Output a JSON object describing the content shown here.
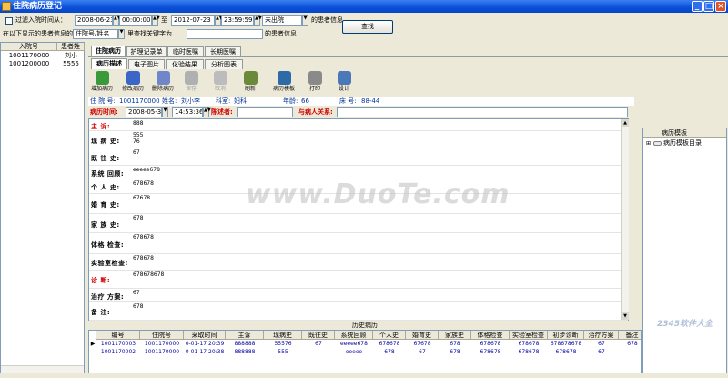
{
  "window": {
    "title": "住院病历登记",
    "icon": "hospital-app-icon"
  },
  "filter": {
    "checkbox_label": "过滤入院时间从：",
    "date_from": "2008-06-23",
    "time_from": "00:00:00",
    "to_label": "至",
    "date_to": "2012-07-23",
    "time_to": "23:59:59",
    "status_value": "未出院",
    "status_suffix": "的患者信息",
    "search_prefix": "在以下显示的患者信息的",
    "search_field": "住院号/姓名",
    "search_mid": "里查找关键字为",
    "search_value": "",
    "search_suffix": "的患者信息",
    "find_button": "查找"
  },
  "patients": {
    "columns": [
      "入院号",
      "患者姓"
    ],
    "rows": [
      [
        "1001170000",
        "刘小"
      ],
      [
        "1001200000",
        "5555"
      ]
    ]
  },
  "main_tabs": [
    "住院病历",
    "护理记录单",
    "临时医嘱",
    "长期医嘱"
  ],
  "sub_tabs": [
    "病历描述",
    "电子图片",
    "化验结果",
    "分析图表"
  ],
  "toolbar": [
    {
      "label": "增加病历",
      "icon": "add-record-icon",
      "color": "#3a9a3a",
      "enabled": true
    },
    {
      "label": "修改病历",
      "icon": "edit-record-icon",
      "color": "#3a66c8",
      "enabled": true
    },
    {
      "label": "删除病历",
      "icon": "delete-record-icon",
      "color": "#6f86c8",
      "enabled": true
    },
    {
      "label": "保存",
      "icon": "save-icon",
      "color": "#9a9a9a",
      "enabled": false
    },
    {
      "label": "取消",
      "icon": "cancel-icon",
      "color": "#a8a8a8",
      "enabled": false
    },
    {
      "label": "刷新",
      "icon": "refresh-icon",
      "color": "#6a8a3a",
      "enabled": true
    },
    {
      "label": "病历模板",
      "icon": "template-icon",
      "color": "#2f6aa8",
      "enabled": true
    },
    {
      "label": "打印",
      "icon": "printer-icon",
      "color": "#8a8a8a",
      "enabled": true
    },
    {
      "label": "设计",
      "icon": "design-icon",
      "color": "#4a78b8",
      "enabled": true
    }
  ],
  "info": {
    "id_label": "住 院 号:",
    "id_value": "1001170000",
    "name_label": "姓名:",
    "name_value": "刘小李",
    "dept_label": "科室:",
    "dept_value": "妇科",
    "age_label": "年龄:",
    "age_value": "66",
    "bed_label": "床 号:",
    "bed_value": "88-44"
  },
  "record_header": {
    "time_label": "病历时间:",
    "date": "2008-05-30",
    "time": "14:53:36",
    "writer_label": "陈述者:",
    "writer_value": "",
    "relation_label": "与病人关系:",
    "relation_value": ""
  },
  "fields": [
    {
      "label": "主   诉:",
      "value": "888",
      "red": true
    },
    {
      "label": "现 病 史:",
      "value": "555\n76",
      "red": false
    },
    {
      "label": "既 往 史:",
      "value": "67",
      "red": false
    },
    {
      "label": "系统 回顾:",
      "value": "eeeee678",
      "red": false
    },
    {
      "label": "个 人 史:",
      "value": "678678",
      "red": false
    },
    {
      "label": "婚 育 史:",
      "value": "67678",
      "red": false
    },
    {
      "label": "家 族 史:",
      "value": "678",
      "red": false
    },
    {
      "label": "体格 检查:",
      "value": "678678",
      "red": false
    },
    {
      "label": "实验室检查:",
      "value": "678678",
      "red": false
    },
    {
      "label": "诊   断:",
      "value": "678678678",
      "red": true
    },
    {
      "label": "治疗 方案:",
      "value": "67",
      "red": false
    },
    {
      "label": "备   注:",
      "value": "678",
      "red": false
    }
  ],
  "templates": {
    "title": "病历模板",
    "root": "病历模板目录"
  },
  "history": {
    "title": "历史病历",
    "columns": [
      "编号",
      "住院号",
      "采取时间",
      "主诉",
      "现病史",
      "既往史",
      "系统回顾",
      "个人史",
      "婚育史",
      "家族史",
      "体格检查",
      "实验室检查",
      "初步诊断",
      "治疗方案",
      "备注"
    ],
    "rows": [
      [
        "1001170003",
        "1001170000",
        "0-01-17 20:39",
        "888888",
        "55576",
        "67",
        "eeeee678",
        "678678",
        "67678",
        "678",
        "678678",
        "678678",
        "678678678",
        "67",
        "678"
      ],
      [
        "1001170002",
        "1001170000",
        "0-01-17 20:38",
        "888888",
        "555",
        "",
        "eeeee",
        "678",
        "67",
        "678",
        "678678",
        "678678",
        "678678",
        "67",
        ""
      ]
    ]
  },
  "watermark": "www.DuoTe.com",
  "corner_watermark": "2345软件大全"
}
